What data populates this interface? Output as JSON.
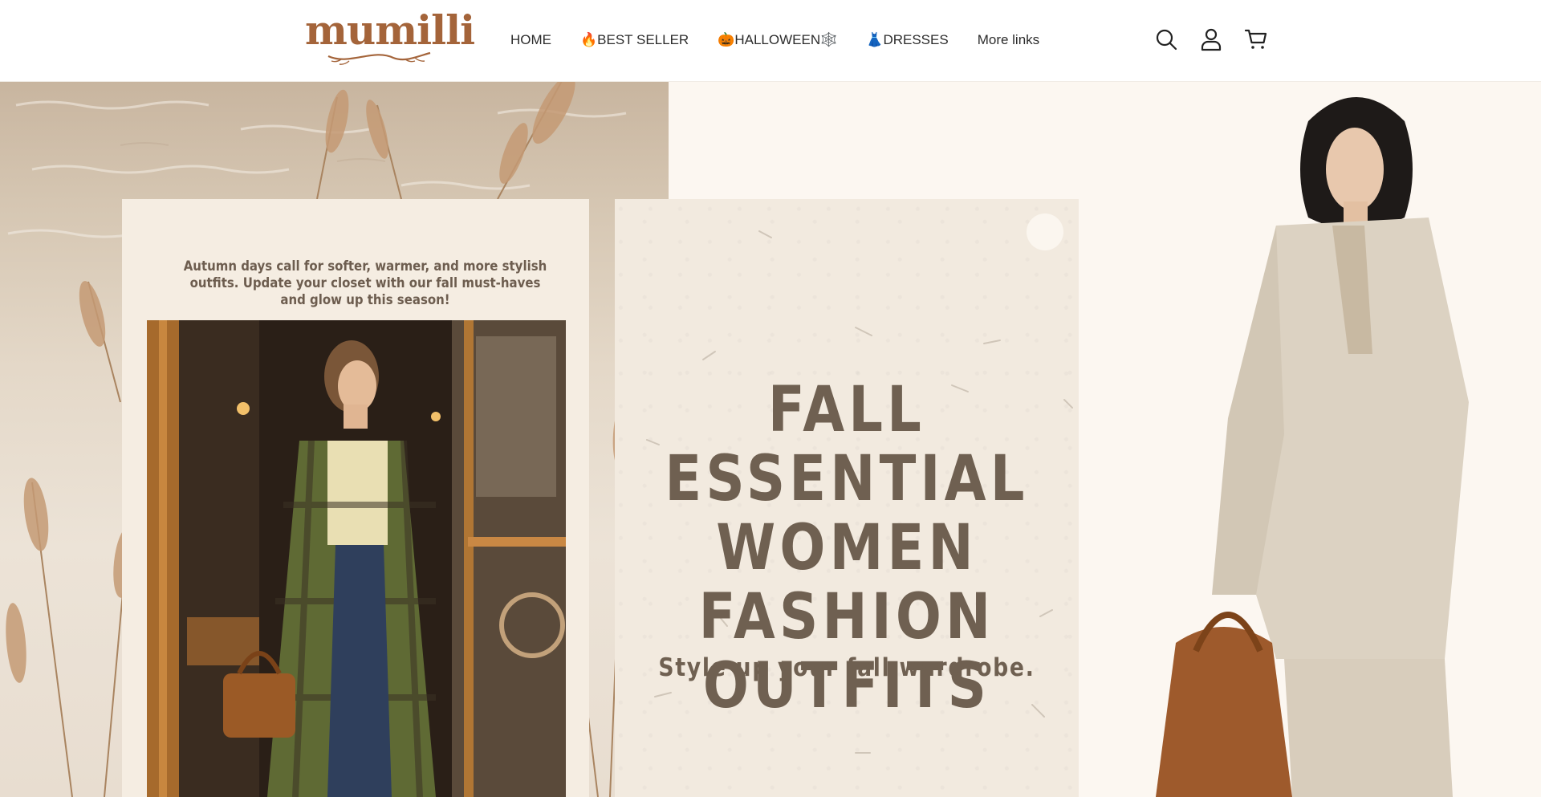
{
  "brand": {
    "logo_text": "mumilli"
  },
  "nav": {
    "items": [
      {
        "label": "HOME"
      },
      {
        "label": "🔥BEST SELLER"
      },
      {
        "label": "🎃HALLOWEEN🕸️"
      },
      {
        "label": "👗DRESSES"
      },
      {
        "label": "More links"
      }
    ]
  },
  "header_icons": [
    "search-icon",
    "account-icon",
    "cart-icon"
  ],
  "hero": {
    "left_text": "Autumn days call for softer, warmer, and more stylish outfits. Update your closet with our fall must-haves and glow up this season!",
    "headline_lines": [
      "FALL ESSENTIAL",
      "WOMEN FASHION",
      "OUTFITS"
    ],
    "subheadline": "Style up your fall wardrobe."
  },
  "colors": {
    "brand": "#a4643a",
    "headline": "#6f6051",
    "card_bg": "#f2eadf",
    "page_bg": "#fdf8f3"
  }
}
